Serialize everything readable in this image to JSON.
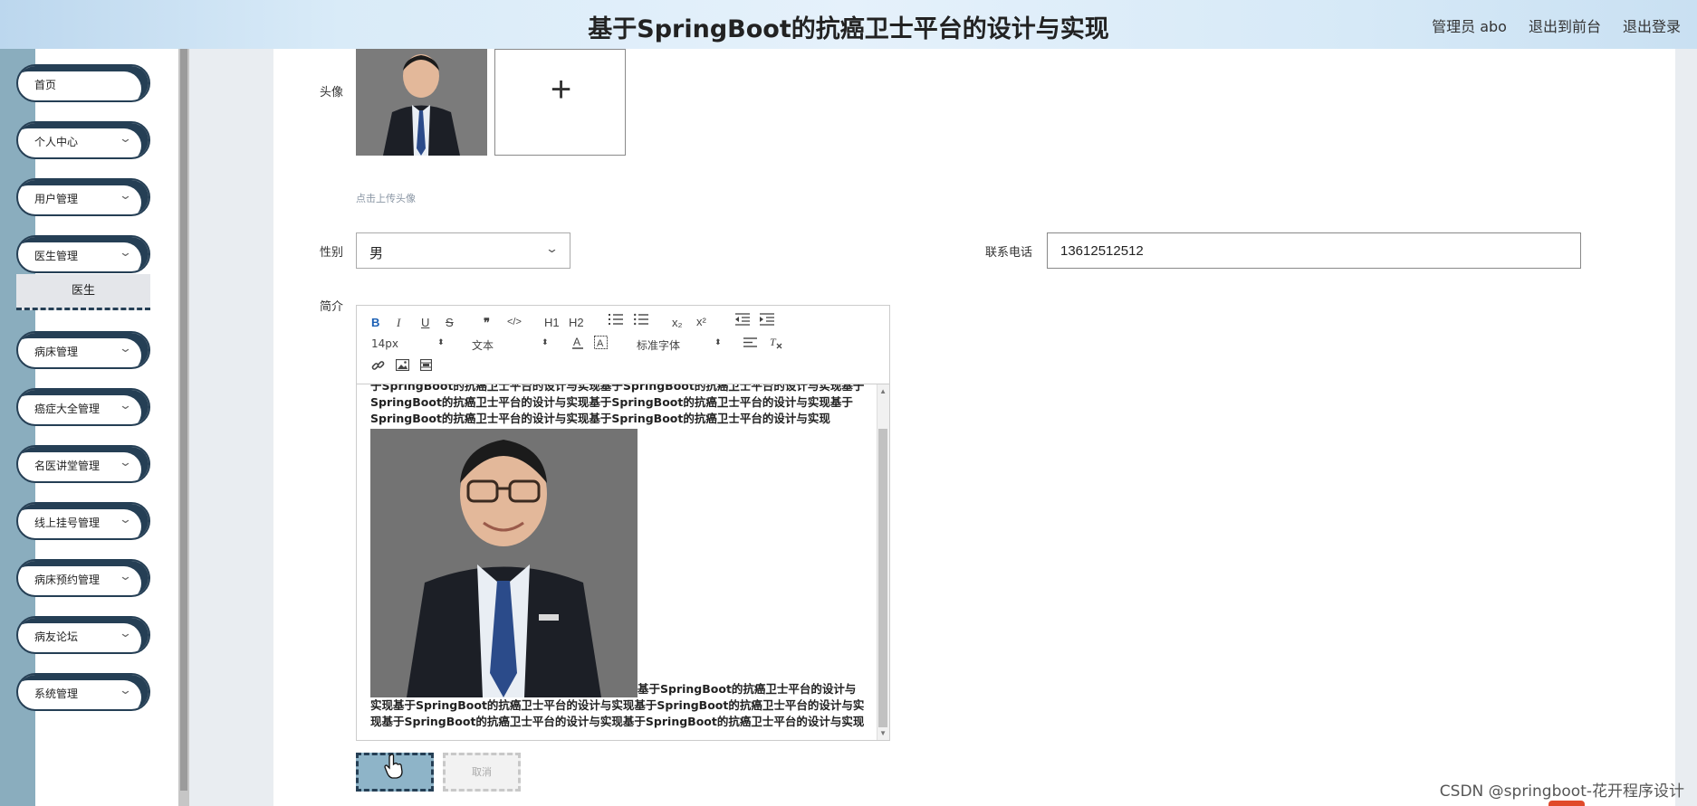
{
  "header": {
    "title": "基于SpringBoot的抗癌卫士平台的设计与实现",
    "user_label": "管理员 abo",
    "front_link": "退出到前台",
    "logout_link": "退出登录"
  },
  "sidebar": {
    "items": [
      {
        "label": "首页"
      },
      {
        "label": "个人中心"
      },
      {
        "label": "用户管理"
      },
      {
        "label": "医生管理"
      },
      {
        "label": "病床管理"
      },
      {
        "label": "癌症大全管理"
      },
      {
        "label": "名医讲堂管理"
      },
      {
        "label": "线上挂号管理"
      },
      {
        "label": "病床预约管理"
      },
      {
        "label": "病友论坛"
      },
      {
        "label": "系统管理"
      }
    ],
    "submenu_label": "医生"
  },
  "form": {
    "avatar_label": "头像",
    "upload_hint": "点击上传头像",
    "gender_label": "性别",
    "gender_value": "男",
    "phone_label": "联系电话",
    "phone_value": "13612512512",
    "intro_label": "简介",
    "save_label": "",
    "cancel_label": "取消"
  },
  "editor": {
    "toolbar": {
      "bold": "B",
      "italic": "I",
      "underline": "U",
      "strike": "S",
      "quote": "❞",
      "code": "</>",
      "h1": "H1",
      "h2": "H2",
      "subscript": "x₂",
      "superscript": "x²",
      "font_size": "14px",
      "header_select": "文本",
      "font_family": "标准字体"
    },
    "text_top": "于SpringBoot的抗癌卫士平台的设计与实现基于SpringBoot的抗癌卫士平台的设计与实现基于SpringBoot的抗癌卫士平台的设计与实现基于SpringBoot的抗癌卫士平台的设计与实现基于SpringBoot的抗癌卫士平台的设计与实现基于SpringBoot的抗癌卫士平台的设计与实现",
    "text_after_image": "基于SpringBoot的抗癌卫士平台的设计与",
    "text_bottom": "实现基于SpringBoot的抗癌卫士平台的设计与实现基于SpringBoot的抗癌卫士平台的设计与实现基于SpringBoot的抗癌卫士平台的设计与实现基于SpringBoot的抗癌卫士平台的设计与实现"
  },
  "watermark": "CSDN @springboot-花开程序设计",
  "colors": {
    "accent_dark": "#253f55",
    "sidebar_stripe": "#8aadbe",
    "save_button": "#8eb4c8"
  }
}
